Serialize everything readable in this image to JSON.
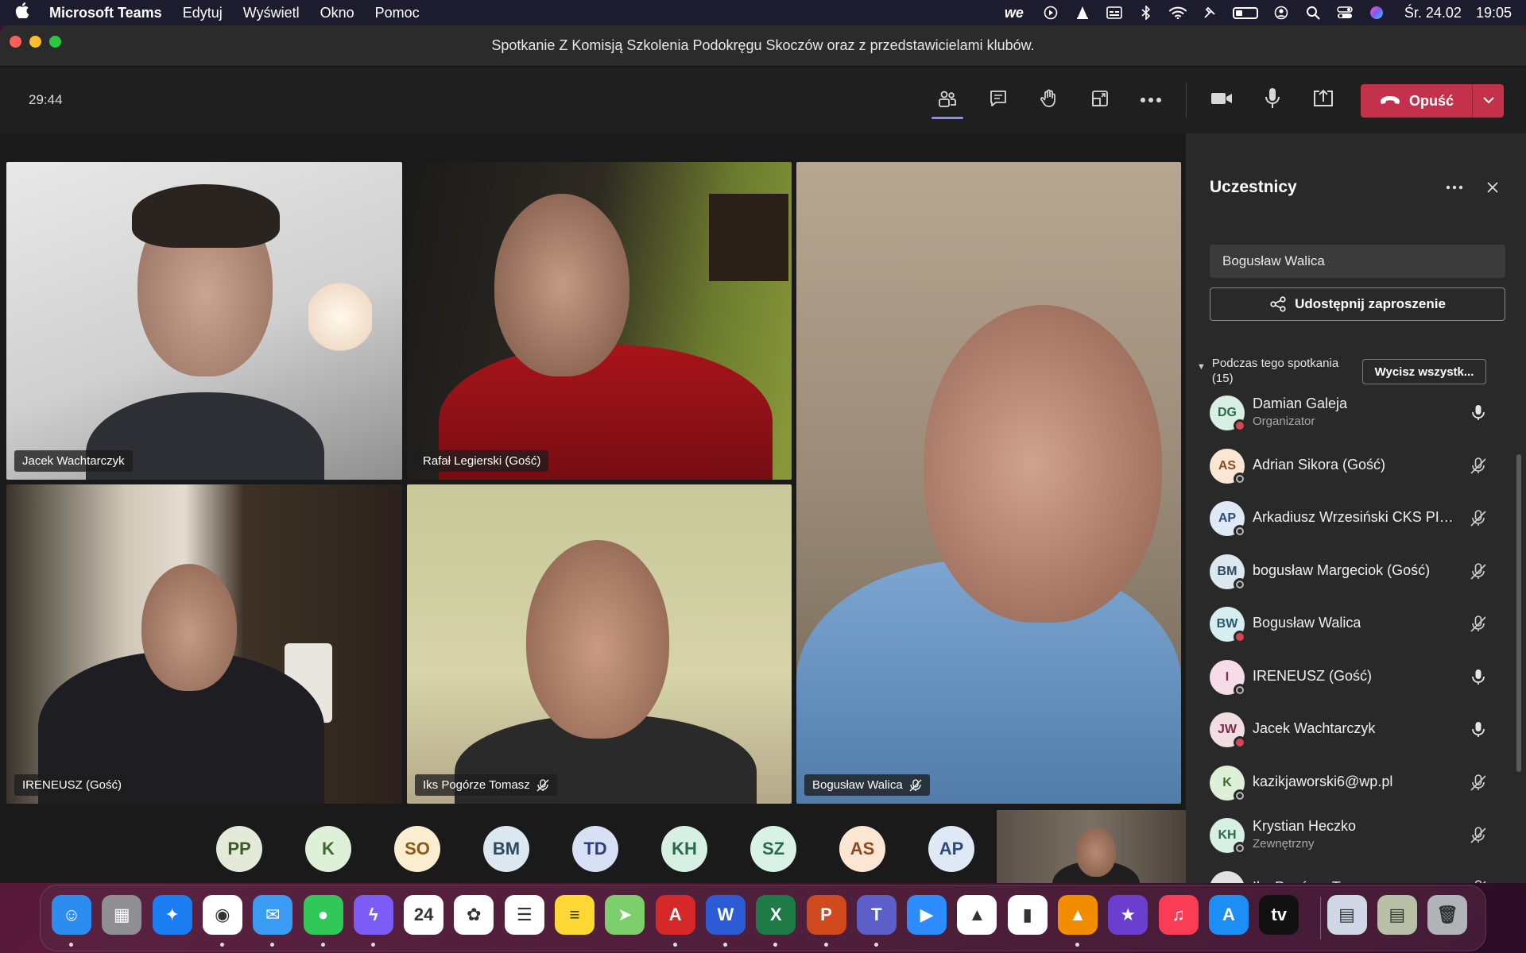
{
  "menubar": {
    "app_name": "Microsoft Teams",
    "menus": [
      "Edytuj",
      "Wyświetl",
      "Okno",
      "Pomoc"
    ],
    "date": "Śr. 24.02",
    "time": "19:05",
    "status_icons": [
      "we-icon",
      "play-icon",
      "vlc-icon",
      "caption-icon",
      "bluetooth-icon",
      "wifi-icon",
      "diagnostics-icon",
      "battery-icon",
      "user-icon",
      "spotlight-icon",
      "control-center-icon",
      "siri-icon"
    ]
  },
  "window": {
    "title": "Spotkanie Z Komisją Szkolenia Podokręgu Skoczów oraz z przedstawicielami klubów."
  },
  "toolbar": {
    "timer": "29:44",
    "leave_label": "Opuść",
    "tools": [
      "participants-icon",
      "chat-icon",
      "raise-hand-icon",
      "rooms-icon",
      "more-icon"
    ],
    "media": [
      "camera-icon",
      "mic-icon",
      "share-screen-icon"
    ]
  },
  "videos": [
    {
      "name": "Jacek Wachtarczyk",
      "muted": false
    },
    {
      "name": "Rafał Legierski (Gość)",
      "muted": false
    },
    {
      "name": "Bogusław Walica",
      "muted": true
    },
    {
      "name": "IRENEUSZ (Gość)",
      "muted": false
    },
    {
      "name": "Iks Pogórze Tomasz",
      "muted": true
    }
  ],
  "avatar_strip": [
    {
      "initials": "PP",
      "bg": "#e3ebd8",
      "fg": "#3d5a2a"
    },
    {
      "initials": "K",
      "bg": "#dff0d8",
      "fg": "#3d6a2f"
    },
    {
      "initials": "SO",
      "bg": "#fbeed0",
      "fg": "#8a5a10"
    },
    {
      "initials": "BM",
      "bg": "#dce8ef",
      "fg": "#2c4a60"
    },
    {
      "initials": "TD",
      "bg": "#d8e0f5",
      "fg": "#2c3f7a"
    },
    {
      "initials": "KH",
      "bg": "#d6f0e4",
      "fg": "#2a6a4a"
    },
    {
      "initials": "SZ",
      "bg": "#d8f2e6",
      "fg": "#2a6a50"
    },
    {
      "initials": "AS",
      "bg": "#fbe6d4",
      "fg": "#8a4a20"
    },
    {
      "initials": "AP",
      "bg": "#dfe8f5",
      "fg": "#2c4a7a"
    }
  ],
  "panel": {
    "title": "Uczestnicy",
    "search_value": "Bogusław Walica",
    "share_label": "Udostępnij zaproszenie",
    "section_label": "Podczas tego spotkania (15)",
    "mute_all_label": "Wycisz wszystk...",
    "participants": [
      {
        "initials": "DG",
        "name": "Damian Galeja",
        "role": "Organizator",
        "status": "busy",
        "mic": "on",
        "bg": "#d8efe4",
        "fg": "#2a6a4a"
      },
      {
        "initials": "AS",
        "name": "Adrian Sikora (Gość)",
        "role": "",
        "status": "away",
        "mic": "off",
        "bg": "#fbe6d4",
        "fg": "#8a4a20"
      },
      {
        "initials": "AP",
        "name": "Arkadiusz Wrzesiński CKS PIA...",
        "role": "",
        "status": "away",
        "mic": "off",
        "bg": "#dfe8f5",
        "fg": "#2c4a7a"
      },
      {
        "initials": "BM",
        "name": "bogusław Margeciok (Gość)",
        "role": "",
        "status": "away",
        "mic": "off",
        "bg": "#dce8ef",
        "fg": "#2c4a60"
      },
      {
        "initials": "BW",
        "name": "Bogusław Walica",
        "role": "",
        "status": "busy",
        "mic": "off",
        "bg": "#d6eef0",
        "fg": "#2a5a6a"
      },
      {
        "initials": "I",
        "name": "IRENEUSZ (Gość)",
        "role": "",
        "status": "away",
        "mic": "on",
        "bg": "#f5dce6",
        "fg": "#8a2a50"
      },
      {
        "initials": "JW",
        "name": "Jacek Wachtarczyk",
        "role": "",
        "status": "busy",
        "mic": "on",
        "bg": "#f2dde2",
        "fg": "#7a2a40"
      },
      {
        "initials": "K",
        "name": "kazikjaworski6@wp.pl",
        "role": "",
        "status": "away",
        "mic": "off",
        "bg": "#dff0d8",
        "fg": "#3d6a2f"
      },
      {
        "initials": "KH",
        "name": "Krystian Heczko",
        "role": "Zewnętrzny",
        "status": "away",
        "mic": "off",
        "bg": "#d6f0e4",
        "fg": "#2a6a4a"
      },
      {
        "initials": "LT",
        "name": "Iks Pogórze Tomasz",
        "role": "",
        "status": "away",
        "mic": "off",
        "bg": "#e2e2e2",
        "fg": "#444444"
      }
    ]
  },
  "dock": {
    "apps": [
      {
        "icon": "finder-icon",
        "bg": "#2d8cf0",
        "glyph": "☺",
        "running": true
      },
      {
        "icon": "launchpad-icon",
        "bg": "#8e8e93",
        "glyph": "▦",
        "running": false
      },
      {
        "icon": "safari-icon",
        "bg": "#1a7ef2",
        "glyph": "✦",
        "running": false
      },
      {
        "icon": "chrome-icon",
        "bg": "#ffffff",
        "glyph": "◉",
        "running": true
      },
      {
        "icon": "mail-icon",
        "bg": "#3b9cf5",
        "glyph": "✉",
        "running": true
      },
      {
        "icon": "messages-icon",
        "bg": "#32c759",
        "glyph": "●",
        "running": true
      },
      {
        "icon": "messenger-icon",
        "bg": "#7b5cf6",
        "glyph": "ϟ",
        "running": true
      },
      {
        "icon": "calendar-icon",
        "bg": "#ffffff",
        "glyph": "24",
        "running": false
      },
      {
        "icon": "photos-icon",
        "bg": "#ffffff",
        "glyph": "✿",
        "running": false
      },
      {
        "icon": "reminders-icon",
        "bg": "#ffffff",
        "glyph": "☰",
        "running": false
      },
      {
        "icon": "notes-icon",
        "bg": "#fdd835",
        "glyph": "≡",
        "running": false
      },
      {
        "icon": "maps-icon",
        "bg": "#7ccf6a",
        "glyph": "➤",
        "running": false
      },
      {
        "icon": "acrobat-icon",
        "bg": "#d62828",
        "glyph": "A",
        "running": true
      },
      {
        "icon": "word-icon",
        "bg": "#2b5cd6",
        "glyph": "W",
        "running": true
      },
      {
        "icon": "excel-icon",
        "bg": "#1e7b45",
        "glyph": "X",
        "running": true
      },
      {
        "icon": "powerpoint-icon",
        "bg": "#d04a1e",
        "glyph": "P",
        "running": true
      },
      {
        "icon": "teams-icon",
        "bg": "#5b5fc7",
        "glyph": "T",
        "running": true
      },
      {
        "icon": "zoom-icon",
        "bg": "#2d8cff",
        "glyph": "▶",
        "running": false
      },
      {
        "icon": "keynote-icon",
        "bg": "#ffffff",
        "glyph": "▲",
        "running": false
      },
      {
        "icon": "numbers-icon",
        "bg": "#ffffff",
        "glyph": "▮",
        "running": false
      },
      {
        "icon": "vlc-icon",
        "bg": "#f28c00",
        "glyph": "▲",
        "running": true
      },
      {
        "icon": "imovie-icon",
        "bg": "#6a3fd0",
        "glyph": "★",
        "running": false
      },
      {
        "icon": "music-icon",
        "bg": "#fa3c55",
        "glyph": "♫",
        "running": false
      },
      {
        "icon": "appstore-icon",
        "bg": "#1c8ef5",
        "glyph": "A",
        "running": false
      },
      {
        "icon": "appletv-icon",
        "bg": "#111111",
        "glyph": "tv",
        "running": false
      },
      {
        "icon": "downloads-stack-icon",
        "bg": "#d0d8e8",
        "glyph": "▤",
        "running": false
      },
      {
        "icon": "documents-stack-icon",
        "bg": "#b8c0a8",
        "glyph": "▤",
        "running": false
      },
      {
        "icon": "trash-icon",
        "bg": "#b0b4b8",
        "glyph": "🗑",
        "running": false
      }
    ]
  }
}
